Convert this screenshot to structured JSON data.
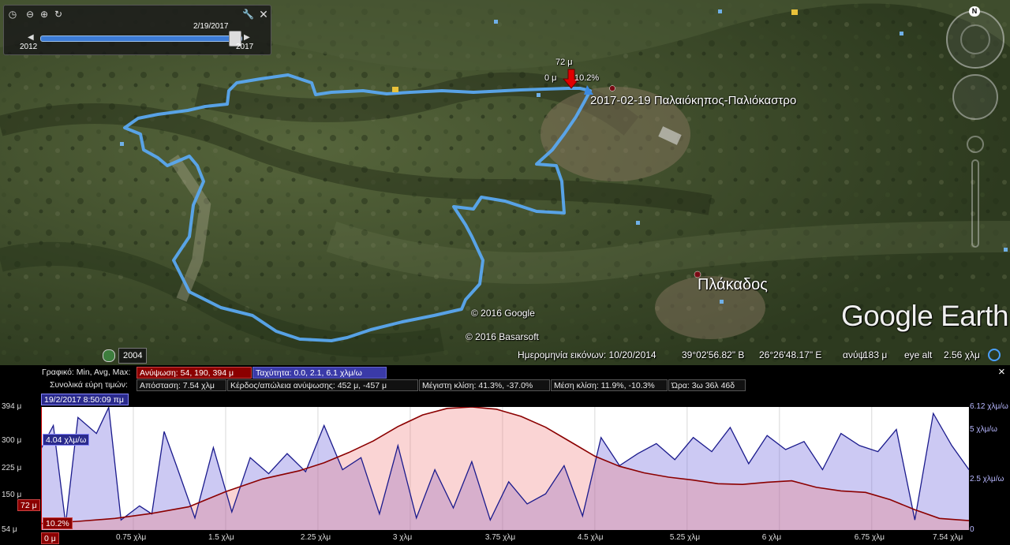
{
  "timeslider": {
    "date": "2/19/2017",
    "start_year": "2012",
    "end_year": "2017",
    "position": 0.97,
    "icons": [
      "clock-icon",
      "zoom-out-icon",
      "zoom-in-icon",
      "refresh-icon",
      "wrench-icon",
      "close-icon"
    ]
  },
  "map": {
    "track_label": "2017-02-19 Παλαιόκηπος-Παλιόκαστρο",
    "place_label": "Πλάκαδος",
    "cursor_elevation": "72 μ",
    "cursor_distance": "0 μ",
    "cursor_slope": "10.2%",
    "copyright_1": "© 2016 Google",
    "copyright_2": "© 2016 Basarsoft",
    "brand": "Google Earth",
    "history_year": "2004",
    "compass_label": "N",
    "colors": {
      "track": "#5aa8f0",
      "marker": "#e00000"
    }
  },
  "statusbar": {
    "imagery_date": "Ημερομηνία εικόνων: 10/20/2014",
    "lat": "39°02'56.82\" Β",
    "lon": "26°26'48.17\" Ε",
    "elev_label": "ανύψ",
    "elev_value": "183 μ",
    "eye_label": "eye alt",
    "eye_value": "2.56 χλμ"
  },
  "profile": {
    "graph_label": "Γραφικό: Min, Avg, Max:",
    "elevation_stats": "Ανύψωση: 54, 190, 394 μ",
    "speed_stats": "Ταχύτητα: 0.0, 2.1, 6.1 χλμ/ω",
    "ranges_label": "Συνολικά εύρη τιμών:",
    "distance": "Απόσταση: 7.54 χλμ",
    "gain_loss": "Κέρδος/απώλεια ανύψωσης: 452 μ, -457 μ",
    "max_slope": "Μέγιστη κλίση: 41.3%, -37.0%",
    "avg_slope": "Μέση κλίση: 11.9%, -10.3%",
    "time": "Ώρα: 3ω 36λ 46δ",
    "timestamp": "19/2/2017 8:50:09 πμ",
    "cursor_speed": "4.04 χλμ/ω",
    "cursor_elev": "72 μ",
    "cursor_slope": "10.2%",
    "cursor_dist": "0 μ",
    "close_label": "×"
  },
  "chart_data": {
    "type": "area",
    "xlabel": "",
    "ylabel": "",
    "xlim": [
      0,
      7.54
    ],
    "ylim": [
      54,
      394
    ],
    "y2lim": [
      0,
      6.12
    ],
    "y_ticks": [
      "394 μ",
      "300 μ",
      "225 μ",
      "150 μ",
      "54 μ"
    ],
    "y_tick_values": [
      394,
      300,
      225,
      150,
      54
    ],
    "y2_ticks": [
      "6.12 χλμ/ω",
      "5 χλμ/ω",
      "2.5 χλμ/ω",
      "0"
    ],
    "y2_tick_values": [
      6.12,
      5,
      2.5,
      0
    ],
    "x_ticks": [
      "0.75 χλμ",
      "1.5 χλμ",
      "2.25 χλμ",
      "3 χλμ",
      "3.75 χλμ",
      "4.5 χλμ",
      "5.25 χλμ",
      "6 χλμ",
      "6.75 χλμ",
      "7.54 χλμ"
    ],
    "x_tick_values": [
      0.75,
      1.5,
      2.25,
      3,
      3.75,
      4.5,
      5.25,
      6,
      6.75,
      7.54
    ],
    "series": [
      {
        "name": "Ανύψωση",
        "color": "#8b0000",
        "x": [
          0,
          0.3,
          0.6,
          0.9,
          1.2,
          1.5,
          1.8,
          2.1,
          2.3,
          2.5,
          2.7,
          2.9,
          3.1,
          3.3,
          3.5,
          3.7,
          3.9,
          4.1,
          4.3,
          4.5,
          4.7,
          4.9,
          5.1,
          5.3,
          5.5,
          5.7,
          5.9,
          6.1,
          6.3,
          6.5,
          6.7,
          6.9,
          7.1,
          7.3,
          7.54
        ],
        "values": [
          72,
          78,
          86,
          100,
          118,
          160,
          195,
          218,
          240,
          268,
          300,
          340,
          372,
          390,
          394,
          388,
          368,
          338,
          298,
          258,
          230,
          212,
          200,
          192,
          182,
          180,
          186,
          190,
          172,
          162,
          158,
          138,
          110,
          86,
          80
        ]
      },
      {
        "name": "Ταχύτητα",
        "color": "#1a1a8c",
        "x": [
          0,
          0.1,
          0.2,
          0.3,
          0.45,
          0.55,
          0.65,
          0.8,
          0.9,
          1.0,
          1.1,
          1.25,
          1.4,
          1.55,
          1.7,
          1.85,
          2.0,
          2.15,
          2.3,
          2.45,
          2.6,
          2.75,
          2.9,
          3.05,
          3.2,
          3.35,
          3.5,
          3.65,
          3.8,
          3.95,
          4.1,
          4.25,
          4.4,
          4.55,
          4.7,
          4.85,
          5.0,
          5.15,
          5.3,
          5.45,
          5.6,
          5.75,
          5.9,
          6.05,
          6.2,
          6.35,
          6.5,
          6.65,
          6.8,
          6.95,
          7.1,
          7.25,
          7.4,
          7.54
        ],
        "values": [
          4.04,
          5.2,
          0.3,
          5.6,
          4.8,
          6.1,
          0.5,
          1.2,
          0.8,
          4.9,
          3.2,
          0.6,
          4.1,
          0.9,
          3.6,
          2.8,
          3.8,
          2.9,
          5.2,
          3.0,
          3.6,
          0.8,
          4.2,
          0.6,
          3.0,
          1.1,
          3.4,
          0.5,
          2.4,
          1.3,
          1.8,
          3.2,
          0.7,
          4.6,
          3.2,
          3.8,
          4.3,
          3.5,
          4.6,
          3.9,
          5.1,
          3.3,
          4.7,
          4.0,
          4.4,
          3.0,
          4.8,
          4.2,
          3.9,
          5.0,
          0.5,
          5.8,
          4.2,
          3.0
        ]
      }
    ]
  }
}
